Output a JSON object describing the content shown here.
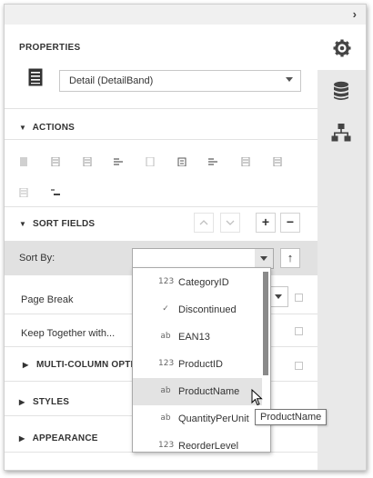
{
  "header": {
    "collapse_icon": "chevron-right-icon"
  },
  "properties": {
    "title": "PROPERTIES",
    "band_selector_value": "Detail (DetailBand)",
    "band_icon": "band-list-icon"
  },
  "right_tabs": [
    {
      "name": "gear-icon"
    },
    {
      "name": "database-icon"
    },
    {
      "name": "hierarchy-icon"
    }
  ],
  "sections": {
    "actions": "ACTIONS",
    "sort_fields": "SORT FIELDS",
    "multi_column": "MULTI-COLUMN OPTIO",
    "styles": "STYLES",
    "appearance": "APPEARANCE"
  },
  "sort": {
    "move_up": "^",
    "move_down": "v",
    "add": "+",
    "remove": "−",
    "sort_by_label": "Sort By:",
    "sort_by_value": "",
    "direction": "↑"
  },
  "props": {
    "page_break_label": "Page Break",
    "keep_together_label": "Keep Together with..."
  },
  "field_list": [
    {
      "icon": "123",
      "label": "CategoryID"
    },
    {
      "icon": "✓",
      "label": "Discontinued"
    },
    {
      "icon": "ab",
      "label": "EAN13"
    },
    {
      "icon": "123",
      "label": "ProductID"
    },
    {
      "icon": "ab",
      "label": "ProductName"
    },
    {
      "icon": "ab",
      "label": "QuantityPerUnit"
    },
    {
      "icon": "123",
      "label": "ReorderLevel"
    }
  ],
  "tooltip": "ProductName",
  "colors": {
    "panel_gray": "#e9e9e9",
    "selected_row": "#e1e1e1",
    "hover_item": "#e3e3e3"
  }
}
